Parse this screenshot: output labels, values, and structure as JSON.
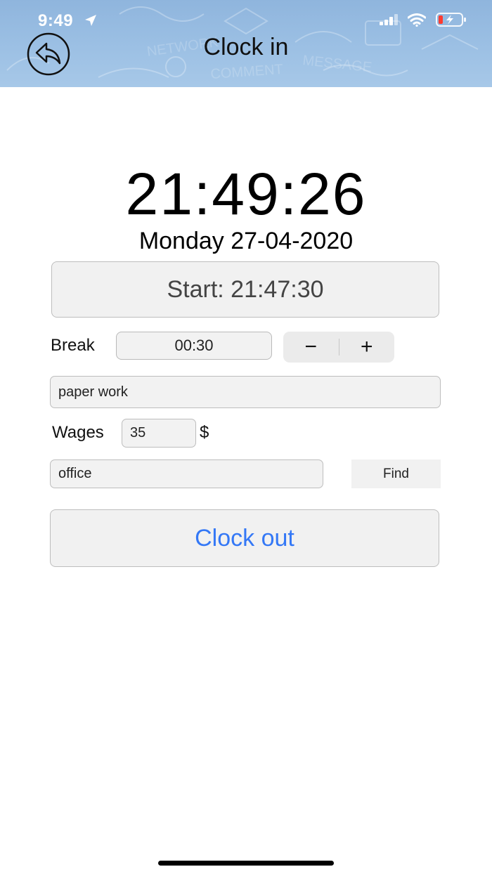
{
  "status_bar": {
    "time": "9:49",
    "icons": [
      "location-arrow-icon",
      "cellular-signal-icon",
      "wifi-icon",
      "battery-charging-icon"
    ]
  },
  "header": {
    "title": "Clock in",
    "back_icon": "back-arrow-icon"
  },
  "clock": {
    "time": "21:49:26",
    "date": "Monday 27-04-2020"
  },
  "start": {
    "label": "Start: 21:47:30"
  },
  "break": {
    "label": "Break",
    "value": "00:30",
    "minus": "−",
    "plus": "+"
  },
  "task": {
    "value": "paper work"
  },
  "wages": {
    "label": "Wages",
    "value": "35",
    "currency": "$"
  },
  "location": {
    "value": "office",
    "find_label": "Find"
  },
  "actions": {
    "clock_out_label": "Clock out"
  },
  "colors": {
    "header_bg": "#9cc0e4",
    "accent": "#3478f6",
    "field_bg": "#f2f2f2",
    "battery_low": "#ff3b30"
  }
}
